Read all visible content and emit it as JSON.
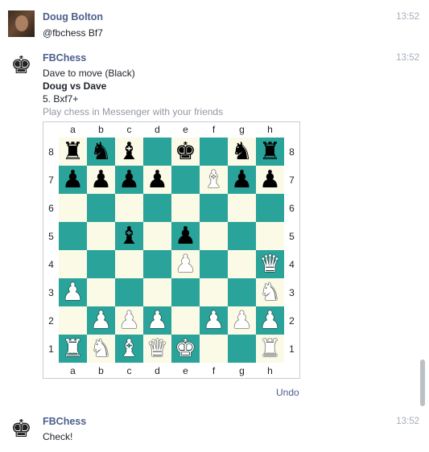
{
  "messages": [
    {
      "sender": "Doug Bolton",
      "time": "13:52",
      "lines": [
        "@fbchess Bf7"
      ]
    },
    {
      "sender": "FBChess",
      "time": "13:52",
      "lines": [
        "Dave to move (Black)",
        "Doug vs Dave",
        "5. Bxf7+",
        "Play chess in Messenger with your friends"
      ],
      "avatar_icon": "♚"
    },
    {
      "sender": "FBChess",
      "time": "13:52",
      "lines": [
        "Check!"
      ],
      "avatar_icon": "♚"
    }
  ],
  "board": {
    "files": [
      "a",
      "b",
      "c",
      "d",
      "e",
      "f",
      "g",
      "h"
    ],
    "ranks": [
      "8",
      "7",
      "6",
      "5",
      "4",
      "3",
      "2",
      "1"
    ],
    "rows": [
      [
        "r",
        "n",
        "b",
        "",
        "k",
        "",
        "n",
        "r"
      ],
      [
        "p",
        "p",
        "p",
        "p",
        "",
        "B",
        "p",
        "p"
      ],
      [
        "",
        "",
        "",
        "",
        "",
        "",
        "",
        ""
      ],
      [
        "",
        "",
        "b",
        "",
        "p",
        "",
        "",
        ""
      ],
      [
        "",
        "",
        "",
        "",
        "P",
        "",
        "",
        "Q"
      ],
      [
        "P",
        "",
        "",
        "",
        "",
        "",
        "",
        "N"
      ],
      [
        "",
        "P",
        "P",
        "P",
        "",
        "P",
        "P",
        "P"
      ],
      [
        "R",
        "N",
        "B",
        "Q",
        "K",
        "",
        "",
        "R"
      ]
    ],
    "light_color": "#fafae6",
    "dark_color": "#2aa39a"
  },
  "undo_label": "Undo",
  "colors": {
    "sender": "#4b5f8c",
    "timestamp": "#a7adb8",
    "hint": "#9197a3"
  }
}
